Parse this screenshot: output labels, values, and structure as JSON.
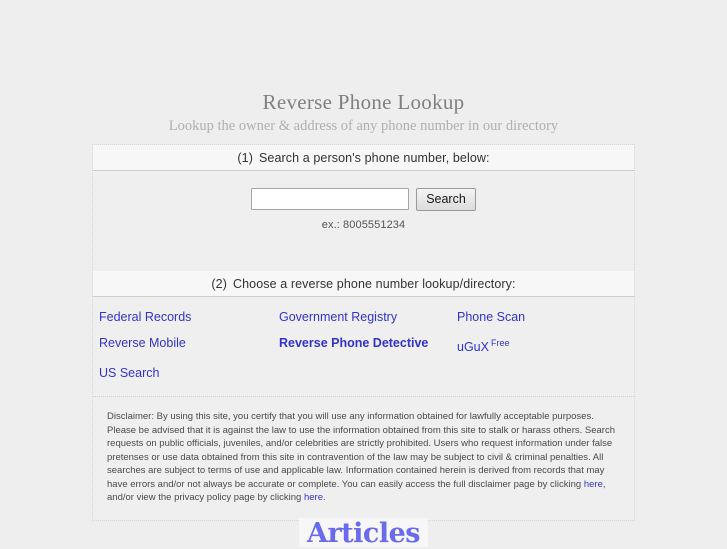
{
  "header": {
    "title": "Reverse Phone Lookup",
    "subtitle": "Lookup the owner & address of any phone number in our directory"
  },
  "search_section": {
    "step_number": "(1)",
    "heading": "Search a person's phone number, below:",
    "input_value": "",
    "input_placeholder": "",
    "button_label": "Search",
    "example": "ex.: 8005551234"
  },
  "directory_section": {
    "step_number": "(2)",
    "heading": "Choose a reverse phone number lookup/directory:",
    "links": [
      {
        "label": "Federal Records",
        "bold": false,
        "superscript": ""
      },
      {
        "label": "Government Registry",
        "bold": false,
        "superscript": ""
      },
      {
        "label": "Phone Scan",
        "bold": false,
        "superscript": ""
      },
      {
        "label": "Reverse Mobile",
        "bold": false,
        "superscript": ""
      },
      {
        "label": "Reverse Phone Detective",
        "bold": true,
        "superscript": ""
      },
      {
        "label": "uGuX",
        "bold": false,
        "superscript": "Free"
      },
      {
        "label": "US Search",
        "bold": false,
        "superscript": ""
      }
    ]
  },
  "disclaimer": {
    "part1": "Disclaimer: By using this site, you certify that you will use any information obtained for lawfully acceptable purposes. Please be advised that it is against the law to use the information obtained from this site to stalk or harass others. Search requests on public officials, juveniles, and/or celebrities are strictly prohibited. Users who request information under false pretenses or use data obtained from this site in contravention of the law may be subject to civil & criminal penalties. All searches are subject to terms of use and applicable law. Information contained herein is derived from records that may have errors and/or not always be accurate or complete. You can easily access the full disclaimer page by clicking ",
    "link1": "here",
    "part2": ", and/or view the privacy policy page by clicking ",
    "link2": "here",
    "part3": "."
  },
  "footer": {
    "logo_text": "Articles"
  },
  "colors": {
    "page_background": "#eeeeee",
    "panel_background": "#efefef",
    "link": "#3333cc",
    "title": "#808080",
    "subtitle": "#b0b0b0",
    "logo": "#6a6aee"
  }
}
